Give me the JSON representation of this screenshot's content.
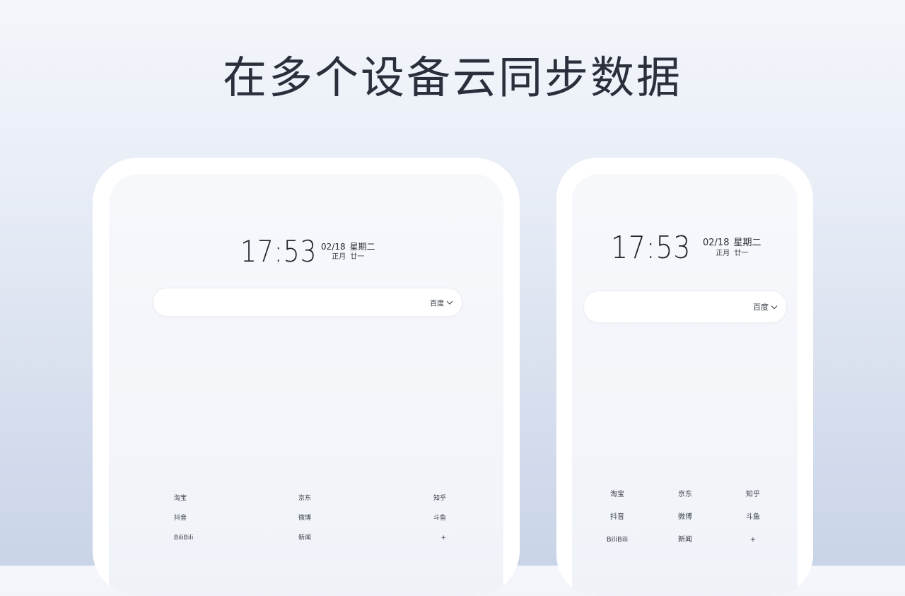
{
  "headline": "在多个设备云同步数据",
  "tablet": {
    "time": "17:53",
    "date": "02/18",
    "weekday": "星期二",
    "lunar_month": "正月",
    "lunar_day": "廿一",
    "search_engine": "百度",
    "shortcuts": [
      "淘宝",
      "京东",
      "知乎",
      "抖音",
      "微博",
      "斗鱼",
      "BiliBili",
      "新闻",
      "+"
    ]
  },
  "phone": {
    "time": "17:53",
    "date": "02/18",
    "weekday": "星期二",
    "lunar_month": "正月",
    "lunar_day": "廿一",
    "search_engine": "百度",
    "shortcuts": [
      "淘宝",
      "京东",
      "知乎",
      "抖音",
      "微博",
      "斗鱼",
      "BiliBili",
      "新闻",
      "+"
    ]
  },
  "colors": {
    "background_top": "#f4f6fb",
    "background_bottom": "#c9d4e8",
    "text_dark": "#2a2f3b",
    "device_frame": "#ffffff"
  }
}
